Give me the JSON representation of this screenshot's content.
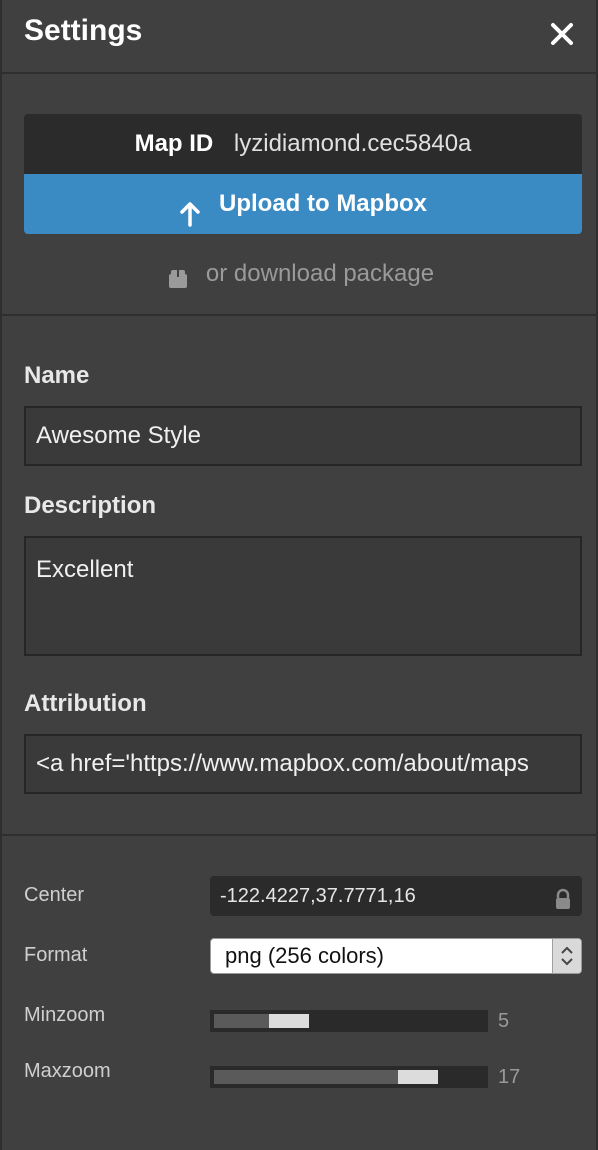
{
  "header": {
    "title": "Settings",
    "close_icon": "close-icon"
  },
  "upload": {
    "map_id_label": "Map ID",
    "map_id_value": "lyzidiamond.cec5840a",
    "upload_label": "Upload to Mapbox",
    "download_label": "or download package",
    "accent_color": "#3a8ac4"
  },
  "form": {
    "name_label": "Name",
    "name_value": "Awesome Style",
    "description_label": "Description",
    "description_value": "Excellent",
    "attribution_label": "Attribution",
    "attribution_value": "<a href='https://www.mapbox.com/about/maps"
  },
  "options": {
    "center_label": "Center",
    "center_value": "-122.4227,37.7771,16",
    "format_label": "Format",
    "format_value": "png (256 colors)",
    "minzoom_label": "Minzoom",
    "minzoom_value": "5",
    "minzoom_fraction": 0.24,
    "maxzoom_label": "Maxzoom",
    "maxzoom_value": "17",
    "maxzoom_fraction": 0.8
  }
}
